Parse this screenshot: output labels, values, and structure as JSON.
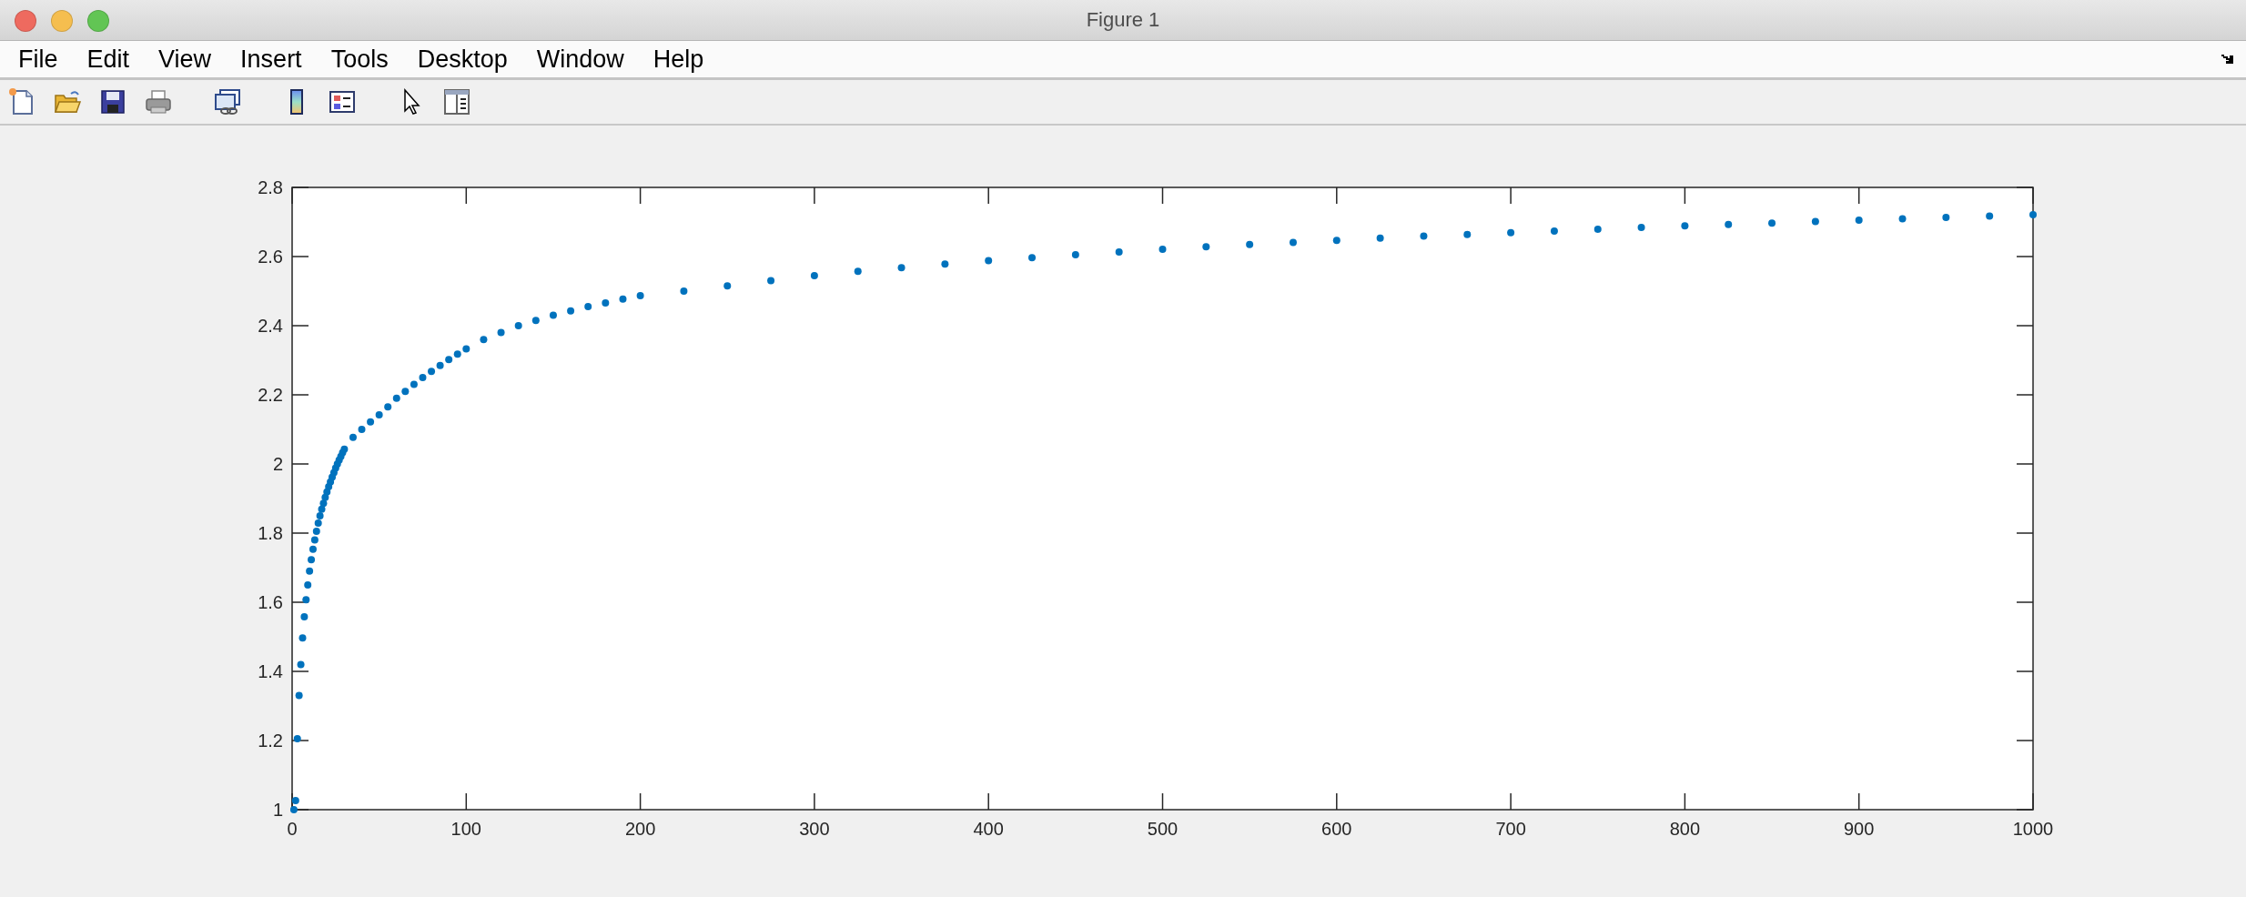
{
  "window": {
    "title": "Figure 1"
  },
  "menu": [
    "File",
    "Edit",
    "View",
    "Insert",
    "Tools",
    "Desktop",
    "Window",
    "Help"
  ],
  "figure": {
    "chart_data": {
      "type": "scatter",
      "xlim": [
        0,
        1000
      ],
      "ylim": [
        1,
        2.8
      ],
      "xticks": [
        0,
        100,
        200,
        300,
        400,
        500,
        600,
        700,
        800,
        900,
        1000
      ],
      "yticks": [
        1,
        1.2,
        1.4,
        1.6,
        1.8,
        2,
        2.2,
        2.4,
        2.6,
        2.8
      ],
      "x": [
        1,
        2,
        3,
        4,
        5,
        6,
        7,
        8,
        9,
        10,
        11,
        12,
        13,
        14,
        15,
        16,
        17,
        18,
        19,
        20,
        21,
        22,
        23,
        24,
        25,
        26,
        27,
        28,
        29,
        30,
        35,
        40,
        45,
        50,
        55,
        60,
        65,
        70,
        75,
        80,
        85,
        90,
        95,
        100,
        110,
        120,
        130,
        140,
        150,
        160,
        170,
        180,
        190,
        200,
        225,
        250,
        275,
        300,
        325,
        350,
        375,
        400,
        425,
        450,
        475,
        500,
        525,
        550,
        575,
        600,
        625,
        650,
        675,
        700,
        725,
        750,
        775,
        800,
        825,
        850,
        875,
        900,
        925,
        950,
        975,
        1000
      ],
      "series": [
        {
          "color": "#0072bd",
          "values": [
            1,
            1.026,
            1.205,
            1.33,
            1.42,
            1.497,
            1.558,
            1.607,
            1.65,
            1.69,
            1.723,
            1.753,
            1.78,
            1.805,
            1.829,
            1.85,
            1.869,
            1.886,
            1.903,
            1.919,
            1.934,
            1.948,
            1.962,
            1.975,
            1.988,
            2,
            2.011,
            2.022,
            2.033,
            2.043,
            2.077,
            2.1,
            2.122,
            2.142,
            2.165,
            2.19,
            2.21,
            2.23,
            2.25,
            2.268,
            2.285,
            2.302,
            2.318,
            2.333,
            2.36,
            2.38,
            2.4,
            2.415,
            2.43,
            2.443,
            2.455,
            2.466,
            2.477,
            2.487,
            2.5,
            2.515,
            2.53,
            2.545,
            2.557,
            2.568,
            2.578,
            2.588,
            2.597,
            2.605,
            2.613,
            2.621,
            2.628,
            2.635,
            2.641,
            2.647,
            2.653,
            2.659,
            2.664,
            2.669,
            2.674,
            2.679,
            2.684,
            2.689,
            2.693,
            2.697,
            2.701,
            2.705,
            2.709,
            2.713,
            2.717,
            2.721
          ]
        }
      ]
    }
  }
}
